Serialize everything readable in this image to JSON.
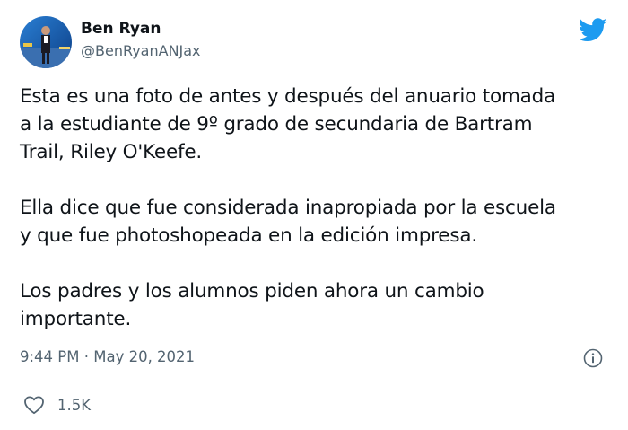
{
  "tweet": {
    "author": {
      "name": "Ben Ryan",
      "handle": "@BenRyanANJax",
      "avatar_icon": "avatar-photo"
    },
    "platform_icon": "twitter-bird-icon",
    "paragraphs": [
      "Esta es una foto de antes y después del anuario tomada\na la estudiante de 9º grado de secundaria de Bartram\nTrail, Riley O'Keefe.",
      "Ella dice que fue considerada inapropiada por la escuela\ny que fue photoshopeada en la edición impresa.",
      "Los padres y los alumnos piden ahora un cambio\nimportante."
    ],
    "timestamp": "9:44 PM · May 20, 2021",
    "likes": "1.5K",
    "colors": {
      "brand": "#1d9bf0",
      "text": "#0f1419",
      "secondary": "#536471",
      "divider": "#cfd9de"
    }
  }
}
